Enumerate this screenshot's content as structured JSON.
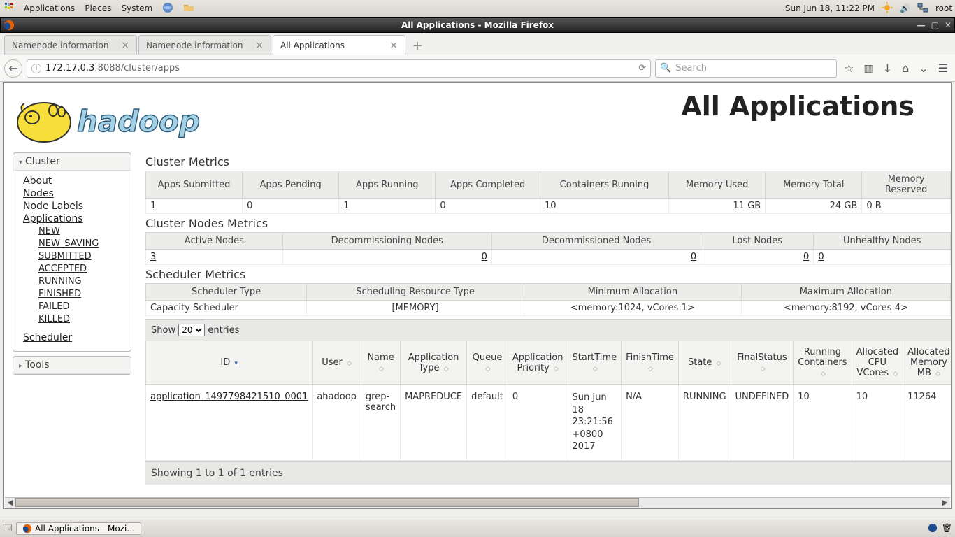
{
  "panel": {
    "applications": "Applications",
    "places": "Places",
    "system": "System",
    "clock": "Sun Jun 18, 11:22 PM",
    "user": "root"
  },
  "window": {
    "title": "All Applications - Mozilla Firefox"
  },
  "tabs": [
    "Namenode information",
    "Namenode information",
    "All Applications"
  ],
  "toolbar": {
    "url_host": "172.17.0.3",
    "url_rest": ":8088/cluster/apps",
    "search_placeholder": "Search"
  },
  "page": {
    "title": "All Applications"
  },
  "sidebar": {
    "cluster_title": "Cluster",
    "about": "About",
    "nodes": "Nodes",
    "node_labels": "Node Labels",
    "applications": "Applications",
    "states": [
      "NEW",
      "NEW_SAVING",
      "SUBMITTED",
      "ACCEPTED",
      "RUNNING",
      "FINISHED",
      "FAILED",
      "KILLED"
    ],
    "scheduler": "Scheduler",
    "tools_title": "Tools"
  },
  "cluster_metrics": {
    "title": "Cluster Metrics",
    "headers": [
      "Apps Submitted",
      "Apps Pending",
      "Apps Running",
      "Apps Completed",
      "Containers Running",
      "Memory Used",
      "Memory Total",
      "Memory Reserved"
    ],
    "values": [
      "1",
      "0",
      "1",
      "0",
      "10",
      "11 GB",
      "24 GB",
      "0 B"
    ]
  },
  "node_metrics": {
    "title": "Cluster Nodes Metrics",
    "headers": [
      "Active Nodes",
      "Decommissioning Nodes",
      "Decommissioned Nodes",
      "Lost Nodes",
      "Unhealthy Nodes"
    ],
    "values": [
      "3",
      "0",
      "0",
      "0",
      "0"
    ]
  },
  "scheduler_metrics": {
    "title": "Scheduler Metrics",
    "headers": [
      "Scheduler Type",
      "Scheduling Resource Type",
      "Minimum Allocation",
      "Maximum Allocation"
    ],
    "values": [
      "Capacity Scheduler",
      "[MEMORY]",
      "<memory:1024, vCores:1>",
      "<memory:8192, vCores:4>"
    ]
  },
  "datatable": {
    "show_prefix": "Show",
    "show_value": "20",
    "show_suffix": "entries",
    "info": "Showing 1 to 1 of 1 entries",
    "columns": [
      "ID",
      "User",
      "Name",
      "Application Type",
      "Queue",
      "Application Priority",
      "StartTime",
      "FinishTime",
      "State",
      "FinalStatus",
      "Running Containers",
      "Allocated CPU VCores",
      "Allocated Memory MB"
    ],
    "row": {
      "id": "application_1497798421510_0001",
      "user": "ahadoop",
      "name": "grep-search",
      "type": "MAPREDUCE",
      "queue": "default",
      "priority": "0",
      "start": "Sun Jun 18 23:21:56 +0800 2017",
      "finish": "N/A",
      "state": "RUNNING",
      "final": "UNDEFINED",
      "running": "10",
      "vcores": "10",
      "mem": "11264"
    }
  },
  "taskbar": {
    "active": "All Applications - Mozi…"
  }
}
